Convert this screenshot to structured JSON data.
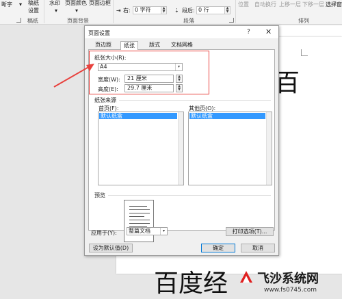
{
  "ribbon": {
    "cut_item": "断字",
    "draft_paper": [
      "稿纸",
      "设置"
    ],
    "draft_group": "稿纸",
    "watermark": "水印",
    "page_color": "页面颜色",
    "page_border": "页面边框",
    "bg_group": "页面背景",
    "indent_right_label": "右:",
    "indent_right_value": "0 字符",
    "spacing_after_label": "段后:",
    "spacing_after_value": "0 行",
    "para_group": "段落",
    "position": "位置",
    "wrap_text": "自动换行",
    "bring_forward": "上移一层",
    "send_backward": "下移一层",
    "select_pane": "选择窗",
    "arrange_group": "排列"
  },
  "dialog": {
    "title": "页面设置",
    "help": "?",
    "close": "✕",
    "tabs": [
      "页边距",
      "纸张",
      "版式",
      "文档网格"
    ],
    "paper_size_label": "纸张大小(R):",
    "paper_size_value": "A4",
    "width_label": "宽度(W):",
    "width_value": "21 厘米",
    "height_label": "高度(E):",
    "height_value": "29.7 厘米",
    "paper_source_label": "纸张来源",
    "first_page_label": "首页(F):",
    "first_page_selected": "默认纸盒",
    "other_pages_label": "其他页(O):",
    "other_pages_selected": "默认纸盒",
    "preview_label": "预览",
    "apply_to_label": "应用于(Y):",
    "apply_to_value": "整篇文档",
    "print_options": "打印选项(T)...",
    "set_default": "设为默认值(D)",
    "ok": "确定",
    "cancel": "取消"
  },
  "document": {
    "char_top": "百",
    "text_bottom": "百度经"
  },
  "watermark": {
    "brand": "飞沙系统网",
    "url": "www.fs0745.com"
  },
  "colors": {
    "annotation_red": "#e8413d",
    "selection_blue": "#3399ff",
    "brand_red": "#e02020"
  },
  "icons": {
    "dropdown": "▾",
    "spin_up": "▲",
    "spin_down": "▼"
  }
}
